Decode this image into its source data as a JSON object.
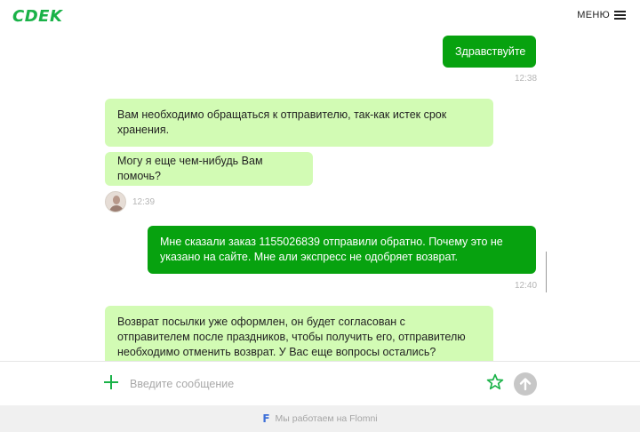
{
  "header": {
    "logo_text": "СDEK",
    "menu_label": "МЕНЮ"
  },
  "messages": [
    {
      "from": "user",
      "text": "Здравствуйте",
      "time": "12:38"
    },
    {
      "from": "operator",
      "text": "Вам необходимо обращаться к отправителю, так-как истек срок хранения."
    },
    {
      "from": "operator",
      "text": "Могу я еще чем-нибудь Вам помочь?",
      "time": "12:39"
    },
    {
      "from": "user",
      "text": "Мне сказали заказ 1155026839 отправили обратно. Почему это не указано на сайте. Мне али экспресс не одобряет возврат.",
      "time": "12:40"
    },
    {
      "from": "operator",
      "text": "Возврат посылки уже оформлен, он будет согласован с отправителем после праздников, чтобы получить его, отправителю необходимо отменить возврат. У Вас еще вопросы остались?"
    }
  ],
  "composer": {
    "placeholder": "Введите сообщение",
    "value": ""
  },
  "footer": {
    "logo": "F",
    "text": "Мы работаем на Flomni"
  },
  "colors": {
    "brand_green": "#1ab248",
    "outgoing_bubble": "#07a20f",
    "incoming_bubble": "#d2fbb4",
    "footer_logo": "#3d6fd8"
  },
  "icons": [
    "menu-icon",
    "avatar",
    "plus-icon",
    "star-icon",
    "send-arrow-icon"
  ]
}
